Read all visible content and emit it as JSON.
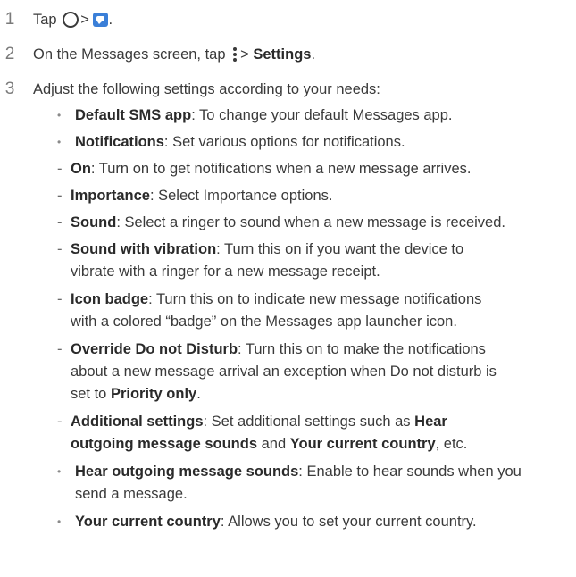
{
  "steps": [
    {
      "number": "1",
      "text_before": "Tap",
      "separator": ">",
      "end": "."
    },
    {
      "number": "2",
      "text_before": "On the Messages screen, tap",
      "separator": ">",
      "bold": "Settings",
      "end": "."
    },
    {
      "number": "3",
      "text": "Adjust the following settings according to your needs:"
    }
  ],
  "settings": [
    {
      "title": "Default SMS app",
      "desc": ": To change your default Messages app."
    },
    {
      "title": "Notifications",
      "desc": ": Set various options for notifications."
    }
  ],
  "notification_options": [
    {
      "title": "On",
      "desc": ": Turn on to get notifications when a new message arrives."
    },
    {
      "title": "Importance",
      "desc": ": Select Importance options."
    },
    {
      "title": "Sound",
      "desc": ": Select a ringer to sound when a new message is received."
    },
    {
      "title": "Sound with vibration",
      "desc": ": Turn this on if you want the device to",
      "desc2": "vibrate with a ringer for a new message receipt."
    },
    {
      "title": "Icon badge",
      "desc": ": Turn this on to indicate new message notifications",
      "desc2": "with a colored “badge” on the Messages app launcher icon."
    },
    {
      "title": "Override Do not Disturb",
      "desc": ": Turn this on to make the notifications",
      "desc2": "about a new message arrival an exception when Do not disturb is",
      "desc3": "set to",
      "bold3": "Priority only",
      "end3": "."
    },
    {
      "title": "Additional settings",
      "desc": ": Set additional settings such as",
      "bold_a": "Hear",
      "bold_b": "outgoing message sounds",
      "mid": " and ",
      "bold_c": "Your current country",
      "end": ", etc."
    }
  ],
  "more_settings": [
    {
      "title": "Hear outgoing message sounds",
      "desc": ": Enable to hear sounds when you",
      "desc2": "send a message."
    },
    {
      "title": "Your current country",
      "desc": ": Allows you to set your current country."
    }
  ],
  "bullet_glyph": "•",
  "dash_glyph": "-",
  "icons": {
    "home": "home-circle-icon",
    "messages": "messages-app-icon",
    "more": "more-options-icon"
  },
  "colors": {
    "text": "#3a3a3a",
    "step_number": "#7a7a7a",
    "messages_icon": "#3a7fd8"
  }
}
